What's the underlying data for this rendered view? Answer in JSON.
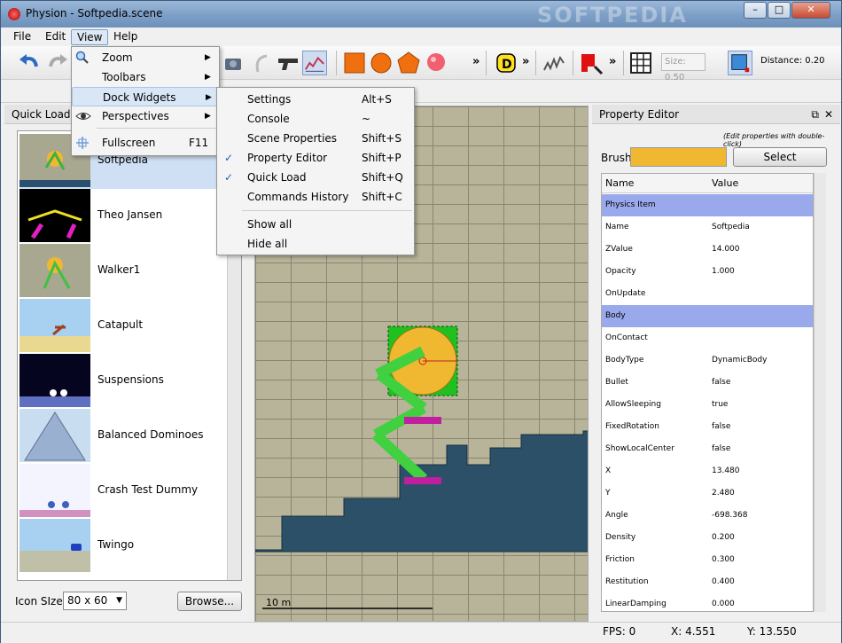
{
  "window": {
    "title": "Physion - Softpedia.scene",
    "watermark": "SOFTPEDIA",
    "min_label": "–",
    "max_label": "□",
    "close_label": "✕"
  },
  "menubar": [
    "File",
    "Edit",
    "View",
    "Help"
  ],
  "toolbar": {
    "size_label": "Size: 0.50",
    "distance_label": "Distance: 0.20",
    "more": "»"
  },
  "view_menu": {
    "items": [
      {
        "label": "Zoom",
        "icon": "magnifier-icon",
        "submenu": true
      },
      {
        "label": "Toolbars",
        "submenu": true
      },
      {
        "label": "Dock Widgets",
        "submenu": true
      },
      {
        "label": "Perspectives",
        "icon": "eye-icon",
        "submenu": true
      },
      {
        "label": "Fullscreen",
        "icon": "fullscreen-icon",
        "shortcut": "F11"
      }
    ]
  },
  "dock_menu": {
    "items": [
      {
        "label": "Settings",
        "shortcut": "Alt+S",
        "checked": false
      },
      {
        "label": "Console",
        "shortcut": "~",
        "checked": false
      },
      {
        "label": "Scene Properties",
        "shortcut": "Shift+S",
        "checked": false
      },
      {
        "label": "Property Editor",
        "shortcut": "Shift+P",
        "checked": true
      },
      {
        "label": "Quick Load",
        "shortcut": "Shift+Q",
        "checked": true
      },
      {
        "label": "Commands History",
        "shortcut": "Shift+C",
        "checked": false
      },
      {
        "label": "Show all"
      },
      {
        "label": "Hide all"
      }
    ]
  },
  "quick_load": {
    "title": "Quick Load",
    "items": [
      "Softpedia",
      "Theo Jansen",
      "Walker1",
      "Catapult",
      "Suspensions",
      "Balanced Dominoes",
      "Crash Test Dummy",
      "Twingo"
    ],
    "icon_size_label": "Icon SIze",
    "icon_size_value": "80 x 60",
    "browse_label": "Browse..."
  },
  "scene": {
    "scale_label": "10 m"
  },
  "property_editor": {
    "title": "Property Editor",
    "hint": "(Edit properties with double-click)",
    "brush_label": "Brush",
    "brush_color": "#f0b830",
    "select_label": "Select",
    "col_name": "Name",
    "col_value": "Value",
    "rows": [
      {
        "name": "Physics Item",
        "value": "",
        "header": true
      },
      {
        "name": "Name",
        "value": "Softpedia"
      },
      {
        "name": "ZValue",
        "value": "14.000"
      },
      {
        "name": "Opacity",
        "value": "1.000"
      },
      {
        "name": "OnUpdate",
        "value": ""
      },
      {
        "name": "Body",
        "value": "",
        "header": true
      },
      {
        "name": "OnContact",
        "value": ""
      },
      {
        "name": "BodyType",
        "value": "DynamicBody"
      },
      {
        "name": "Bullet",
        "value": "false"
      },
      {
        "name": "AllowSleeping",
        "value": "true"
      },
      {
        "name": "FixedRotation",
        "value": "false"
      },
      {
        "name": "ShowLocalCenter",
        "value": "false"
      },
      {
        "name": "X",
        "value": "13.480"
      },
      {
        "name": "Y",
        "value": "2.480"
      },
      {
        "name": "Angle",
        "value": "-698.368"
      },
      {
        "name": "Density",
        "value": "0.200"
      },
      {
        "name": "Friction",
        "value": "0.300"
      },
      {
        "name": "Restitution",
        "value": "0.400"
      },
      {
        "name": "LinearDamping",
        "value": "0.000"
      }
    ]
  },
  "status": {
    "fps": "FPS: 0",
    "x": "X: 4.551",
    "y": "Y: 13.550"
  }
}
